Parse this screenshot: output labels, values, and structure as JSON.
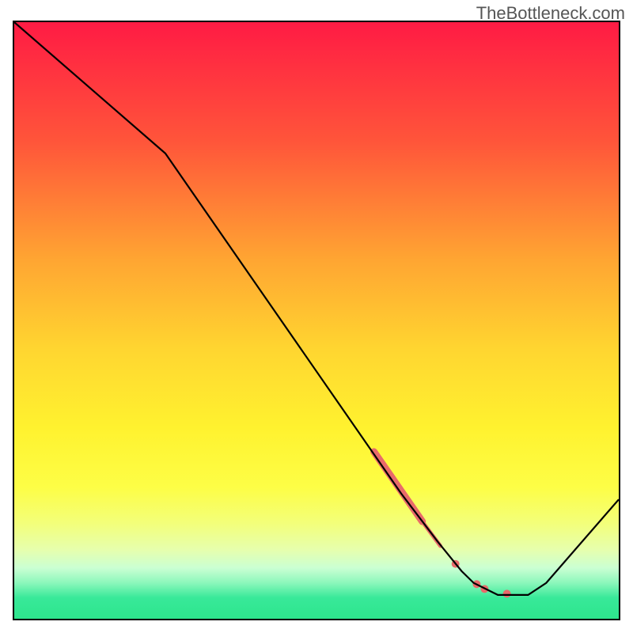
{
  "watermark": "TheBottleneck.com",
  "chart_data": {
    "type": "line",
    "title": "",
    "xlabel": "",
    "ylabel": "",
    "xlim": [
      0,
      100
    ],
    "ylim": [
      0,
      100
    ],
    "grid": false,
    "background": {
      "type": "vertical-gradient",
      "stops": [
        {
          "offset": 0.0,
          "color": "#ff1b44"
        },
        {
          "offset": 0.2,
          "color": "#ff553a"
        },
        {
          "offset": 0.4,
          "color": "#ffa632"
        },
        {
          "offset": 0.55,
          "color": "#ffd630"
        },
        {
          "offset": 0.68,
          "color": "#fff22f"
        },
        {
          "offset": 0.78,
          "color": "#fdfe46"
        },
        {
          "offset": 0.84,
          "color": "#f3ff7a"
        },
        {
          "offset": 0.885,
          "color": "#e6ffae"
        },
        {
          "offset": 0.915,
          "color": "#caffd3"
        },
        {
          "offset": 0.94,
          "color": "#8bf7bb"
        },
        {
          "offset": 0.965,
          "color": "#38e999"
        },
        {
          "offset": 1.0,
          "color": "#2de58d"
        }
      ]
    },
    "series": [
      {
        "name": "bottleneck-curve",
        "color": "#000000",
        "x": [
          0,
          25,
          64,
          70,
          74,
          76,
          80,
          85,
          88,
          100
        ],
        "y": [
          100,
          78,
          21,
          13,
          8,
          6,
          4,
          4,
          6,
          20
        ]
      }
    ],
    "markers": [
      {
        "name": "highlight-segment-top",
        "type": "thick-line",
        "color": "#e86a6a",
        "width": 9,
        "x": [
          59.5,
          67.5
        ],
        "y": [
          28.0,
          16.3
        ]
      },
      {
        "name": "highlight-segment-thin",
        "type": "thick-line",
        "color": "#e86a6a",
        "width": 5,
        "x": [
          67.5,
          70.5
        ],
        "y": [
          16.3,
          12.2
        ]
      },
      {
        "name": "marker-dot-1",
        "type": "dot",
        "color": "#e86a6a",
        "radius": 5,
        "x": 73,
        "y": 9.2
      },
      {
        "name": "marker-dot-2",
        "type": "dot",
        "color": "#e86a6a",
        "radius": 5,
        "x": 76.5,
        "y": 5.8
      },
      {
        "name": "marker-dot-3",
        "type": "dot",
        "color": "#e86a6a",
        "radius": 5,
        "x": 77.8,
        "y": 5.0
      },
      {
        "name": "marker-dot-4",
        "type": "dot",
        "color": "#e86a6a",
        "radius": 5,
        "x": 81.5,
        "y": 4.2
      }
    ]
  }
}
